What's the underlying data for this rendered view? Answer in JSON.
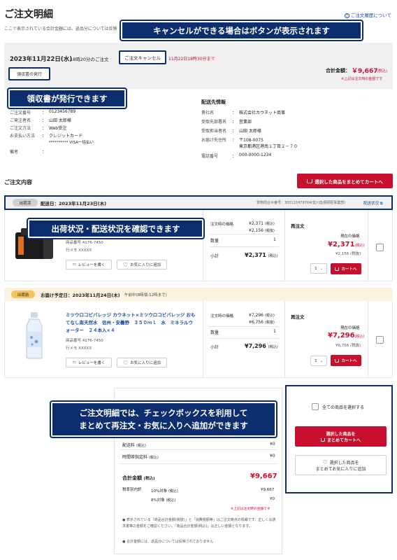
{
  "header": {
    "title": "ご注文明細",
    "history_link": "ご注文履歴について",
    "description": "ここで表示されている合計金額には、返品分については反映"
  },
  "order": {
    "date": "2023年11月22日(水)",
    "time": "18時20分のご注文",
    "cancel_button": "ご注文キャンセル",
    "cancel_deadline": "11月22日18時30分まで",
    "receipt_button": "領収書の発行",
    "total_label": "合計金額：",
    "total_value": "￥9,667",
    "total_tax": "(税込)",
    "total_note": "※上記は注文時の金額です",
    "info": [
      {
        "label": "ご注文番号",
        "value": "0123456789"
      },
      {
        "label": "ご発注者名",
        "value": "山田 太郎様"
      },
      {
        "label": "ご注文方法",
        "value": "Web受注"
      },
      {
        "label": "お支払い方法",
        "value": "クレジットカード",
        "value2": "********** VISA一括払い"
      },
      {
        "label": "備考",
        "value": ""
      }
    ],
    "shipping_title": "配送先情報",
    "shipping": [
      {
        "label": "貴社名",
        "value": "株式会社カウネット商事"
      },
      {
        "label": "受取先部署名",
        "value": "営業部"
      },
      {
        "label": "受取担当者名",
        "value": "山田 太郎様"
      },
      {
        "label": "お届け先住所",
        "value": "〒108-0075",
        "value2": "東京都港区港南１丁目２－７０"
      },
      {
        "label": "電話番号",
        "value": "000-0000-1234"
      }
    ]
  },
  "callouts": {
    "cancel": "キャンセルができる場合はボタンが表示されます",
    "receipt": "領収書が発行できます",
    "shipping": "出荷状況・配送状況を確認できます",
    "bulk_line1": "ご注文明細では、チェックボックスを利用して",
    "bulk_line2": "まとめて再注文・お気に入りへ追加ができます"
  },
  "contents": {
    "title": "ご注文内容",
    "bulk_cart_button": "選択した商品をまとめてカートへ"
  },
  "shipment1": {
    "status": "出荷済",
    "date": "配送日：2023年11月23日(木)",
    "tracking": "貨物問合せ番号：300115479764(佐川急便即配事業部)",
    "tracking_link": "配送状況",
    "product_no": "商品番号 4176-7450",
    "memo": "行メモ XXXXX",
    "order_price_label": "注文時の価格",
    "order_price": "¥2,371",
    "order_price_tax": "(税込)",
    "order_price_ex": "¥2,156",
    "order_price_ex_tax": "(税抜)",
    "qty_label": "数量",
    "qty": "1",
    "subtotal_label": "小計",
    "subtotal": "¥2,371",
    "subtotal_tax": "(税込)",
    "reorder_title": "再注文",
    "current_label": "現在の価格",
    "current_price": "¥2,371",
    "current_tax": "(税込)",
    "current_ex": "¥2,156 (税抜)",
    "qty_select": "1",
    "cart_button": "カートへ",
    "review_button": "レビューを書く",
    "fav_button": "お気に入りに追加"
  },
  "shipment2": {
    "status": "出荷前",
    "date": "お届け予定日：2023年11月24日(木)",
    "time_slot": "午前中(8時頃-12時まで)",
    "product_name": "ミツウロコビバレッジ カウネット×ミツウロコビバレッジ おもてなし南天然水　信州・安曇野　３５０ｍｌ　水　ミネラルウォーター　２４本入×４",
    "product_no": "商品番号 4176-7450",
    "memo": "行メモ XXXXX",
    "order_price_label": "注文時の価格",
    "order_price": "¥7,296",
    "order_price_tax": "(税込)",
    "order_price_ex": "¥6,756",
    "order_price_ex_tax": "(税抜)",
    "qty_label": "数量",
    "qty": "1",
    "subtotal_label": "小計",
    "subtotal": "¥7,296",
    "subtotal_tax": "(税込)",
    "reorder_title": "再注文",
    "current_label": "現在の価格",
    "current_price": "¥7,296",
    "current_tax": "(税込)",
    "current_ex": "¥6,756 (税抜)",
    "qty_select": "1",
    "cart_button": "カートへ",
    "review_button": "レビューを書く",
    "fav_button": "お気に入りに追加"
  },
  "summary": {
    "rows": [
      {
        "label": "配送料",
        "tax": "(税込)",
        "value": "¥0"
      },
      {
        "label": "時間帯指定料",
        "tax": "(税込)",
        "value": "¥0"
      }
    ],
    "total_label": "合計金額",
    "total_tax": "(税込)",
    "total_value": "¥9,667",
    "breakdown_label": "税率別内訳",
    "rate10_label": "10%対象",
    "rate10_tax": "(税込)",
    "rate10_value": "¥9,667",
    "rate8_label": "8%対象",
    "rate8_tax": "(税込)",
    "rate8_value": "¥0",
    "note_red": "※上記は注文時の金額です",
    "note1": "表示されている「商品合計金額(税抜)」と「消費税額等」はご注文時点の情報です。正しくは請求書等の金額をご確認ください。「商品合計金額(税込)」は正しい金額となります。",
    "note2": "合計金額には、返品分については反映されておりません"
  },
  "bulk_panel": {
    "select_all": "全ての商品を選択する",
    "cart_line1": "選択した商品を",
    "cart_line2": "まとめてカートへ",
    "fav_line1": "選択した商品を",
    "fav_line2": "まとめてお気に入りに追加"
  },
  "colors": {
    "accent": "#c8102e",
    "callout": "#0d2e6e",
    "header_bg": "#f0f0f0"
  }
}
